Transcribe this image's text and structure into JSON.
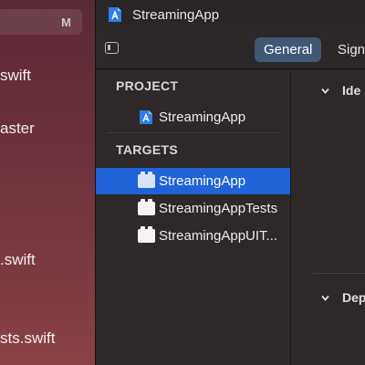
{
  "navigator": {
    "badge": "M",
    "files": [
      "swift",
      "aster",
      ".swift",
      "sts.swift"
    ]
  },
  "window": {
    "title": "StreamingApp",
    "title_icon": "xcode-project-icon"
  },
  "tabs": [
    {
      "label": "General",
      "active": true
    },
    {
      "label": "Signi",
      "active": false
    }
  ],
  "project_section": {
    "header": "PROJECT",
    "items": [
      {
        "label": "StreamingApp",
        "icon": "xcode-project-icon"
      }
    ]
  },
  "targets_section": {
    "header": "TARGETS",
    "items": [
      {
        "label": "StreamingApp",
        "icon": "app-target-icon",
        "selected": true
      },
      {
        "label": "StreamingAppTests",
        "icon": "test-target-icon",
        "selected": false
      },
      {
        "label": "StreamingAppUIT...",
        "icon": "test-target-icon",
        "selected": false
      }
    ]
  },
  "editor": {
    "sections": [
      {
        "label": "Ide",
        "expanded": true
      },
      {
        "label": "Dep",
        "expanded": true
      }
    ]
  },
  "colors": {
    "selection": "#1f63d6",
    "active_tab": "#3e5876",
    "sidebar": "#6a2f3a"
  }
}
